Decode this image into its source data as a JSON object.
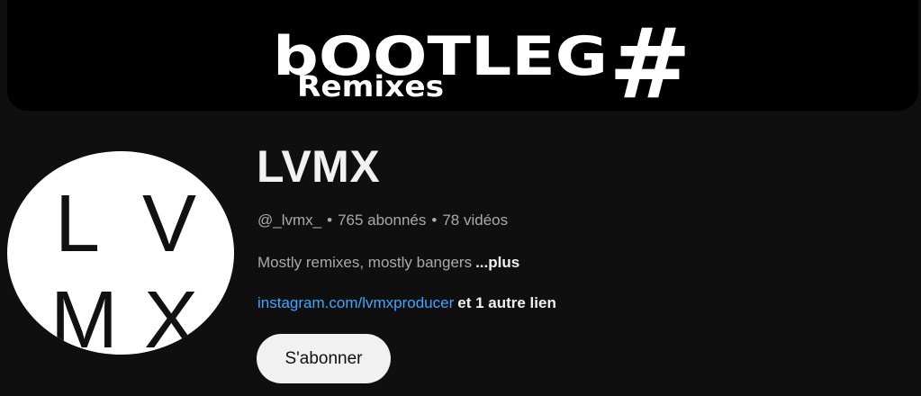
{
  "banner": {
    "logo_main": "bOOTLEG",
    "logo_hash": "#",
    "logo_sub": "Remixes"
  },
  "avatar": {
    "letters": [
      "L",
      "V",
      "M",
      "X"
    ]
  },
  "channel": {
    "name": "LVMX",
    "handle": "@_lvmx_",
    "separator": "•",
    "subscribers": "765 abonnés",
    "videos": "78 vidéos",
    "description": "Mostly remixes, mostly bangers",
    "more_label": "...plus",
    "link_text": "instagram.com/lvmxproducer",
    "other_links": "et 1 autre lien",
    "subscribe_label": "S'abonner"
  },
  "colors": {
    "background": "#0f0f0f",
    "link": "#3ea6ff",
    "secondary_text": "#aaaaaa",
    "subscribe_bg": "#f1f1f1"
  }
}
